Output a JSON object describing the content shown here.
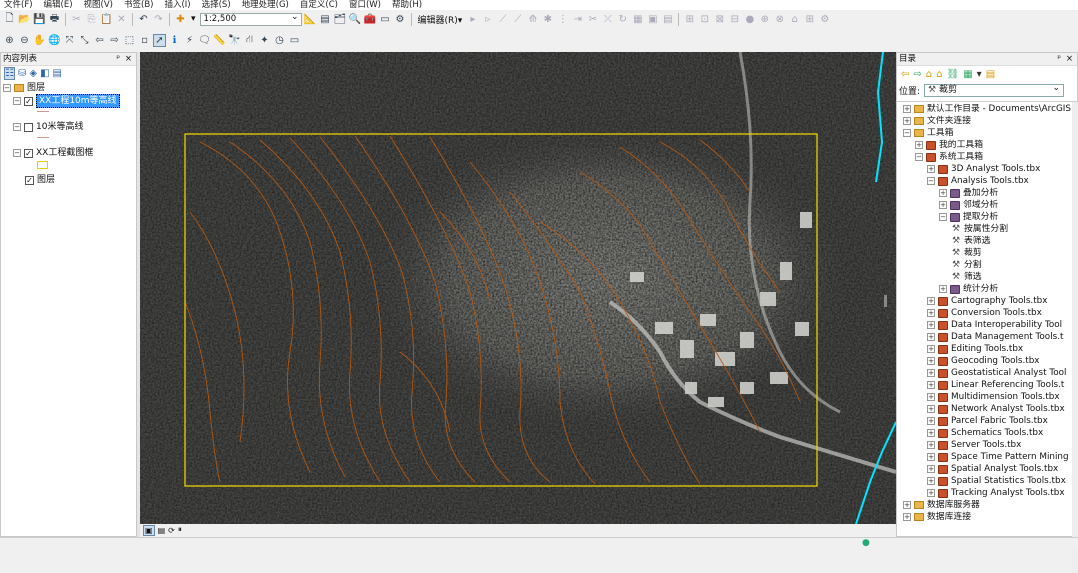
{
  "menu": [
    "文件(F)",
    "编辑(E)",
    "视图(V)",
    "书签(B)",
    "插入(I)",
    "选择(S)",
    "地理处理(G)",
    "自定义(C)",
    "窗口(W)",
    "帮助(H)"
  ],
  "toolbar1": {
    "scale_value": "1:2,500",
    "editor_label": "编辑器(R)▾"
  },
  "toc": {
    "title": "内容列表",
    "layers_root": "图层",
    "items": [
      {
        "label": "XX工程10m等高线",
        "checked": true,
        "selected": true
      },
      {
        "label": "10米等高线",
        "checked": false
      },
      {
        "label": "XX工程截图框",
        "checked": true
      },
      {
        "label": "图层",
        "checked": true
      }
    ]
  },
  "catalog": {
    "title": "目录",
    "location_label": "位置:",
    "location_value": "裁剪",
    "tree": [
      {
        "level": 0,
        "label": "默认工作目录 - Documents\\ArcGIS",
        "exp": "+",
        "icon": "fold"
      },
      {
        "level": 0,
        "label": "文件夹连接",
        "exp": "+",
        "icon": "fold"
      },
      {
        "level": 0,
        "label": "工具箱",
        "exp": "−",
        "icon": "fold"
      },
      {
        "level": 1,
        "label": "我的工具箱",
        "exp": "+",
        "icon": "tbx"
      },
      {
        "level": 1,
        "label": "系统工具箱",
        "exp": "−",
        "icon": "tbx"
      },
      {
        "level": 2,
        "label": "3D Analyst Tools.tbx",
        "exp": "+",
        "icon": "tbx"
      },
      {
        "level": 2,
        "label": "Analysis Tools.tbx",
        "exp": "−",
        "icon": "tbx"
      },
      {
        "level": 3,
        "label": "叠加分析",
        "exp": "+",
        "icon": "tbxg"
      },
      {
        "level": 3,
        "label": "邻域分析",
        "exp": "+",
        "icon": "tbxg"
      },
      {
        "level": 3,
        "label": "提取分析",
        "exp": "−",
        "icon": "tbxg"
      },
      {
        "level": 4,
        "label": "按属性分割",
        "exp": "",
        "icon": "hammer"
      },
      {
        "level": 4,
        "label": "表筛选",
        "exp": "",
        "icon": "hammer"
      },
      {
        "level": 4,
        "label": "裁剪",
        "exp": "",
        "icon": "hammer"
      },
      {
        "level": 4,
        "label": "分割",
        "exp": "",
        "icon": "hammer"
      },
      {
        "level": 4,
        "label": "筛选",
        "exp": "",
        "icon": "hammer"
      },
      {
        "level": 3,
        "label": "统计分析",
        "exp": "+",
        "icon": "tbxg"
      },
      {
        "level": 2,
        "label": "Cartography Tools.tbx",
        "exp": "+",
        "icon": "tbx"
      },
      {
        "level": 2,
        "label": "Conversion Tools.tbx",
        "exp": "+",
        "icon": "tbx"
      },
      {
        "level": 2,
        "label": "Data Interoperability Tool",
        "exp": "+",
        "icon": "tbx"
      },
      {
        "level": 2,
        "label": "Data Management Tools.t",
        "exp": "+",
        "icon": "tbx"
      },
      {
        "level": 2,
        "label": "Editing Tools.tbx",
        "exp": "+",
        "icon": "tbx"
      },
      {
        "level": 2,
        "label": "Geocoding Tools.tbx",
        "exp": "+",
        "icon": "tbx"
      },
      {
        "level": 2,
        "label": "Geostatistical Analyst Tool",
        "exp": "+",
        "icon": "tbx"
      },
      {
        "level": 2,
        "label": "Linear Referencing Tools.t",
        "exp": "+",
        "icon": "tbx"
      },
      {
        "level": 2,
        "label": "Multidimension Tools.tbx",
        "exp": "+",
        "icon": "tbx"
      },
      {
        "level": 2,
        "label": "Network Analyst Tools.tbx",
        "exp": "+",
        "icon": "tbx"
      },
      {
        "level": 2,
        "label": "Parcel Fabric Tools.tbx",
        "exp": "+",
        "icon": "tbx"
      },
      {
        "level": 2,
        "label": "Schematics Tools.tbx",
        "exp": "+",
        "icon": "tbx"
      },
      {
        "level": 2,
        "label": "Server Tools.tbx",
        "exp": "+",
        "icon": "tbx"
      },
      {
        "level": 2,
        "label": "Space Time Pattern Mining",
        "exp": "+",
        "icon": "tbx"
      },
      {
        "level": 2,
        "label": "Spatial Analyst Tools.tbx",
        "exp": "+",
        "icon": "tbx"
      },
      {
        "level": 2,
        "label": "Spatial Statistics Tools.tbx",
        "exp": "+",
        "icon": "tbx"
      },
      {
        "level": 2,
        "label": "Tracking Analyst Tools.tbx",
        "exp": "+",
        "icon": "tbx"
      },
      {
        "level": 0,
        "label": "数据库服务器",
        "exp": "+",
        "icon": "fold"
      },
      {
        "level": 0,
        "label": "数据库连接",
        "exp": "+",
        "icon": "fold"
      }
    ]
  },
  "colors": {
    "accent": "#3399ff",
    "frame": "#e8d100",
    "contour": "#b85a10",
    "river": "#00e5ff"
  }
}
